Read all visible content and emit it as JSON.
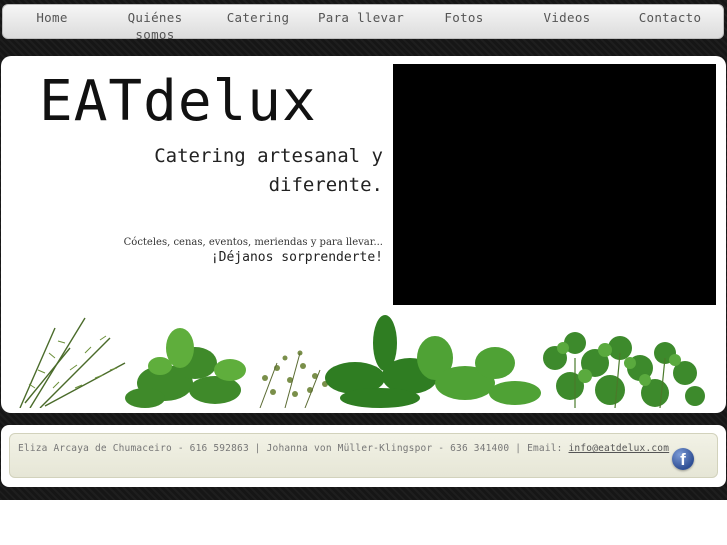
{
  "nav": {
    "items": [
      {
        "label": "Home"
      },
      {
        "label": "Quiénes somos"
      },
      {
        "label": "Catering"
      },
      {
        "label": "Para llevar"
      },
      {
        "label": "Fotos"
      },
      {
        "label": "Videos"
      },
      {
        "label": "Contacto"
      }
    ]
  },
  "hero": {
    "title": "EATdelux",
    "tagline": "Catering artesanal y diferente.",
    "services": "Cócteles, cenas, eventos, meriendas y para llevar...",
    "cta": "¡Déjanos sorprenderte!"
  },
  "footer": {
    "contact_text": "Eliza Arcaya de Chumaceiro - 616 592863 | Johanna von Müller-Klingspor - 636 341400 | Email: ",
    "email": "info@eatdelux.com",
    "social_icon": "facebook-icon"
  },
  "colors": {
    "background": "#161616",
    "footer_bar": "#eeeee2",
    "facebook": "#3b5998"
  }
}
